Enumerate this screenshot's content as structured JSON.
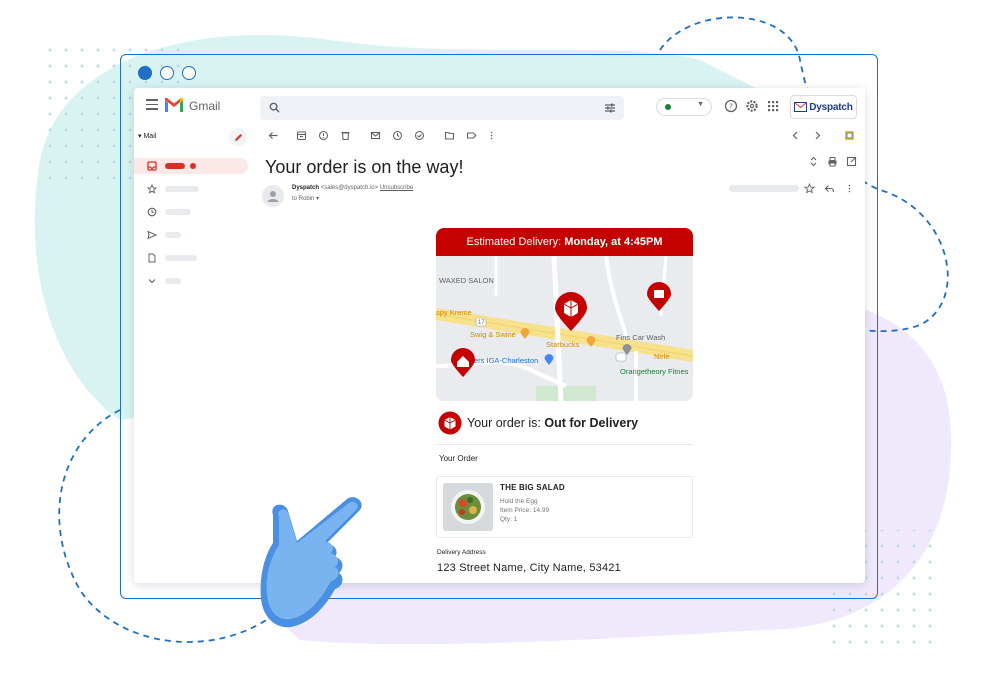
{
  "colors": {
    "frame": "#1f6fc5",
    "brand_red": "#c40000",
    "background_teal": "#d8f3f2",
    "background_lavender": "#efe9fb",
    "status_green": "#188038"
  },
  "app": {
    "name": "Gmail",
    "search_placeholder": ""
  },
  "brand_button": {
    "label": "Dyspatch",
    "icon": "envelope-icon"
  },
  "sidebar": {
    "mail_label": "Mail",
    "items": [
      {
        "icon": "inbox-icon",
        "active": true
      },
      {
        "icon": "star-icon",
        "active": false
      },
      {
        "icon": "clock-icon",
        "active": false
      },
      {
        "icon": "send-icon",
        "active": false
      },
      {
        "icon": "document-icon",
        "active": false
      },
      {
        "icon": "chevron-down-icon",
        "active": false
      }
    ]
  },
  "email": {
    "subject": "Your order is on the way!",
    "sender_name": "Dyspatch",
    "sender_email": "<sales@dyspatch.io>",
    "unsubscribe": "Unsubscribe",
    "to": "to Robin"
  },
  "order": {
    "banner_prefix": "Estimated Delivery: ",
    "banner_time": "Monday, at 4:45PM",
    "status_prefix": "Your order is: ",
    "status_value": "Out for Delivery",
    "section_title": "Your Order",
    "item": {
      "name": "THE BIG SALAD",
      "note": "Hold the Egg",
      "price": "Item Price: 14.99",
      "qty": "Qty: 1"
    },
    "address_label": "Delivery Address",
    "address": "123 Street Name, City Name, 53421"
  },
  "map": {
    "labels": {
      "salon": "WAXED SALON",
      "kreme": "spy Kreme",
      "swig": "Swig & Swine",
      "starbucks": "Starbucks",
      "carwash": "Fins Car Wash",
      "iga": "ers IGA-Charleston",
      "orangetheory": "Orangetheory Fitnes",
      "nirle": "Nirle",
      "road17": "17"
    }
  }
}
